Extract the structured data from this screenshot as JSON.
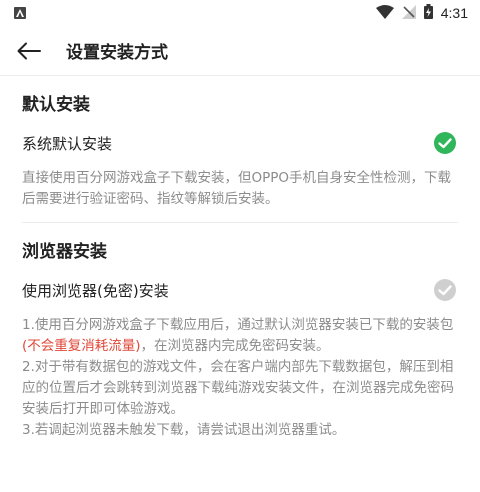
{
  "status_bar": {
    "time": "4:31"
  },
  "header": {
    "title": "设置安装方式"
  },
  "sections": [
    {
      "title": "默认安装",
      "option_label": "系统默认安装",
      "selected": true,
      "description": "直接使用百分网游戏盒子下载安装，但OPPO手机自身安全性检测，下载后需要进行验证密码、指纹等解锁后安装。"
    },
    {
      "title": "浏览器安装",
      "option_label": "使用浏览器(免密)安装",
      "selected": false,
      "desc1_before": "1.使用百分网游戏盒子下载应用后，通过默认浏览器安装已下载的安装包",
      "desc1_highlight": "(不会重复消耗流量)",
      "desc1_after": "，在浏览器内完成免密码安装。",
      "desc2": "2.对于带有数据包的游戏文件，会在客户端内部先下载数据包，解压到相应的位置后才会跳转到浏览器下载纯游戏安装文件，在浏览器完成免密码安装后打开即可体验游戏。",
      "desc3": "3.若调起浏览器未触发下载，请尝试退出浏览器重试。"
    }
  ],
  "colors": {
    "checked": "#2fb55a",
    "unchecked": "#cfcfcf",
    "highlight": "#e0483a"
  },
  "icons": {
    "back": "arrow-left-icon",
    "check": "check-circle-icon",
    "wifi": "wifi-icon",
    "battery": "battery-charging-icon",
    "signal": "no-signal-icon"
  }
}
